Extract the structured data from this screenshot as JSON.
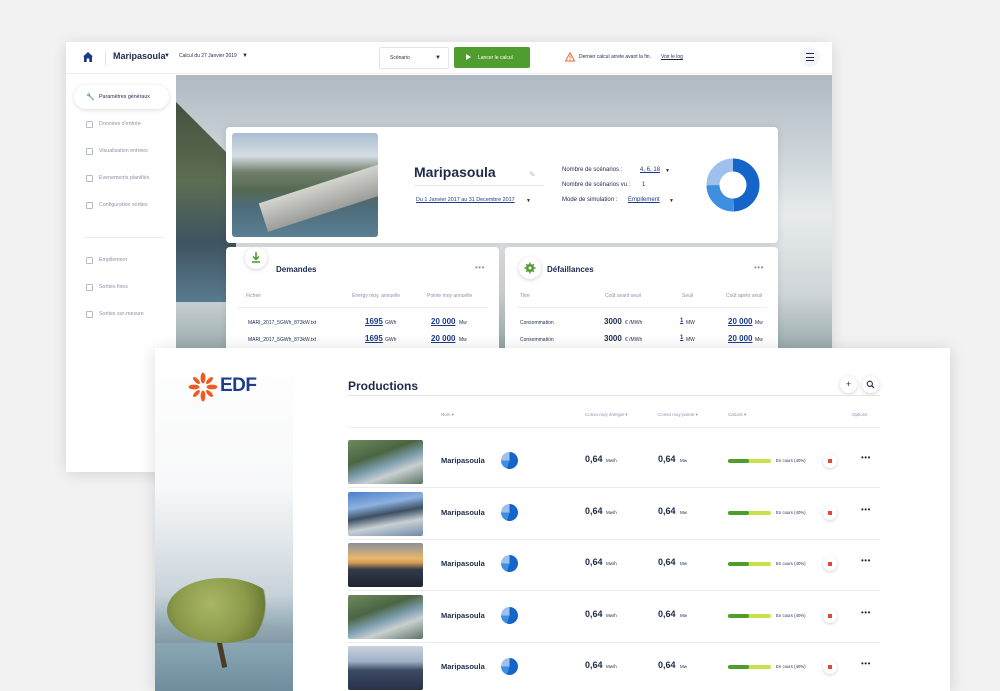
{
  "back_window": {
    "topbar": {
      "site": "Maripasoula",
      "calc": "Calcul du 27 Janvier 2019",
      "scenario_select": "Scénario",
      "run_button": "Lancer le calcul",
      "warning": "Dernier calcul arrete avant la fin.",
      "warning_link": "Voir le log"
    },
    "sidebar": {
      "items": [
        {
          "label": "Paramètres généraux",
          "active": true
        },
        {
          "label": "Données d'entrée"
        },
        {
          "label": "Visualisation entrées"
        },
        {
          "label": "Evenements planifiés"
        },
        {
          "label": "Configuration sorties"
        },
        {
          "label": "Empilement"
        },
        {
          "label": "Sorties fixes"
        },
        {
          "label": "Sorties sur-mesure"
        }
      ]
    },
    "summary": {
      "title": "Maripasoula",
      "date_range": "Du 1 Janvier 2017 au 31 Decembre 2017",
      "rows": [
        {
          "label": "Nombre de scénarios :",
          "value": "4, 6, 18"
        },
        {
          "label": "Nombre de scénarios vu :",
          "value": "1"
        },
        {
          "label": "Mode de simulation :",
          "value": "Empilement"
        }
      ],
      "donut_colors": [
        "#1565c8",
        "#3f8fe0",
        "#9ec0ec"
      ]
    },
    "demandes": {
      "title": "Demandes",
      "headers": [
        "Fichier",
        "Energy moy. annuelle",
        "Pointe moy annuelle"
      ],
      "rows": [
        {
          "file": "MARI_2017_5GWh_873kW.txt",
          "energy": "1695",
          "energy_unit": "GWh",
          "peak": "20 000",
          "peak_unit": "Mw"
        },
        {
          "file": "MARI_2017_5GWh_873kW.txt",
          "energy": "1695",
          "energy_unit": "GWh",
          "peak": "20 000",
          "peak_unit": "Mw"
        }
      ]
    },
    "defaillances": {
      "title": "Défaillances",
      "headers": [
        "Titre",
        "Coût avant seuil",
        "Seuil",
        "Coût après seuil"
      ],
      "rows": [
        {
          "title": "Consommation",
          "cost_before": "3000",
          "cost_unit": "€ /MWh",
          "threshold": "1",
          "threshold_unit": "MW",
          "cost_after": "20 000",
          "cost_after_unit": "Mw"
        },
        {
          "title": "Consommation",
          "cost_before": "3000",
          "cost_unit": "€ /MWh",
          "threshold": "1",
          "threshold_unit": "MW",
          "cost_after": "20 000",
          "cost_after_unit": "Mw"
        }
      ]
    }
  },
  "front_window": {
    "logo": "EDF",
    "title": "Productions",
    "headers": [
      "Nom",
      "Conso moy énergie",
      "Conso moy pointe",
      "Calculs",
      "Options"
    ],
    "rows": [
      {
        "name": "Maripasoula",
        "energy": "0,64",
        "energy_unit": "Mw/h",
        "peak": "0,64",
        "peak_unit": "Mw",
        "progress": 0.4,
        "status": "En cours (40%)",
        "thumb": "dam"
      },
      {
        "name": "Maripasoula",
        "energy": "0,64",
        "energy_unit": "Mw/h",
        "peak": "0,64",
        "peak_unit": "Mw",
        "progress": 0.4,
        "status": "En cours (40%)",
        "thumb": "dam-blue"
      },
      {
        "name": "Maripasoula",
        "energy": "0,64",
        "energy_unit": "Mw/h",
        "peak": "0,64",
        "peak_unit": "Mw",
        "progress": 0.4,
        "status": "En cours (40%)",
        "thumb": "solar-sunset"
      },
      {
        "name": "Maripasoula",
        "energy": "0,64",
        "energy_unit": "Mw/h",
        "peak": "0,64",
        "peak_unit": "Mw",
        "progress": 0.4,
        "status": "En cours (40%)",
        "thumb": "dam"
      },
      {
        "name": "Maripasoula",
        "energy": "0,64",
        "energy_unit": "Mw/h",
        "peak": "0,64",
        "peak_unit": "Mw",
        "progress": 0.4,
        "status": "En cours (40%)",
        "thumb": "solar"
      }
    ]
  }
}
